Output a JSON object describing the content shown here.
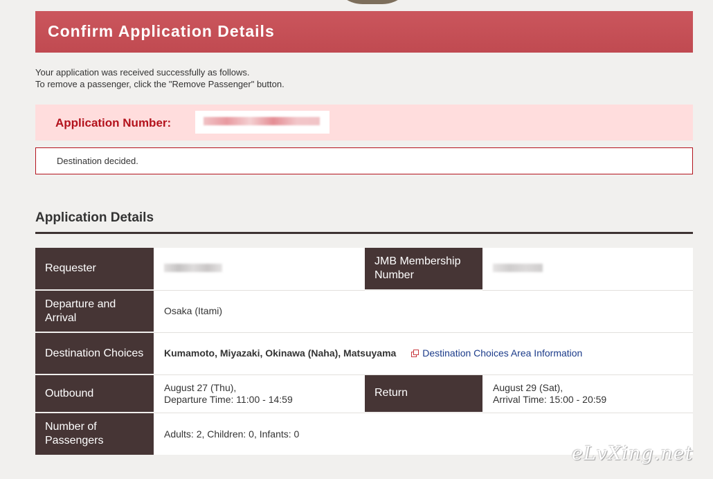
{
  "header": {
    "title": "Confirm Application Details"
  },
  "intro": {
    "line1": "Your application was received successfully as follows.",
    "line2": "To remove a passenger, click the \"Remove Passenger\" button."
  },
  "application": {
    "number_label": "Application Number:"
  },
  "notice": {
    "text": "Destination decided."
  },
  "section": {
    "title": "Application Details"
  },
  "details": {
    "requester_label": "Requester",
    "jmb_label": "JMB Membership Number",
    "departure_label": "Departure and Arrival",
    "departure_value": "Osaka (Itami)",
    "destinations_label": "Destination Choices",
    "destinations_value": "Kumamoto, Miyazaki, Okinawa (Naha), Matsuyama",
    "destinations_link": "Destination Choices Area Information",
    "outbound_label": "Outbound",
    "outbound_date": "August 27 (Thu),",
    "outbound_time": "Departure Time: 11:00 - 14:59",
    "return_label": "Return",
    "return_date": "August 29 (Sat),",
    "return_time": "Arrival Time: 15:00 - 20:59",
    "passengers_label": "Number of Passengers",
    "passengers_value": "Adults: 2, Children: 0, Infants: 0"
  },
  "watermark": "eLvXing.net",
  "colors": {
    "banner": "#c84d54",
    "label_cell": "#463535",
    "highlight_bg": "#ffdddd",
    "accent_red": "#b3121c",
    "link": "#1b3b8a"
  },
  "icons": {
    "external_link": "external-link-icon"
  }
}
